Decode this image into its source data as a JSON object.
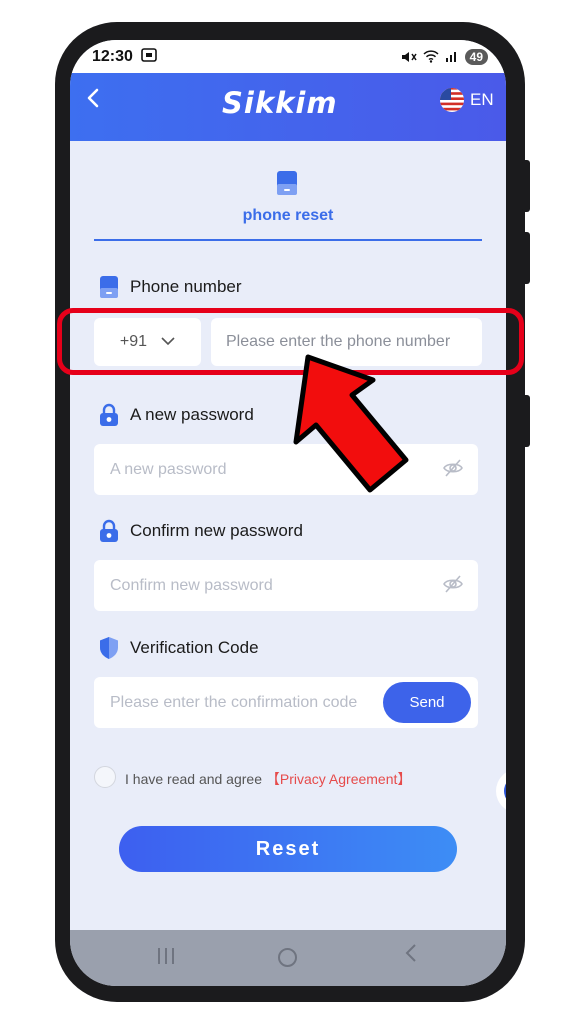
{
  "status_bar": {
    "time": "12:30",
    "battery": "49"
  },
  "header": {
    "logo": "Sikkim",
    "language": "EN"
  },
  "tab": {
    "label": "phone reset"
  },
  "phone": {
    "label": "Phone number",
    "country_code": "+91",
    "placeholder": "Please enter the phone number"
  },
  "password": {
    "label": "A new password",
    "placeholder": "A new password"
  },
  "confirm": {
    "label": "Confirm new password",
    "placeholder": "Confirm new password"
  },
  "verification": {
    "label": "Verification Code",
    "placeholder": "Please enter the confirmation code",
    "send_label": "Send"
  },
  "agreement": {
    "text": "I have read and agree",
    "link": "【Privacy Agreement】"
  },
  "reset_label": "Reset",
  "colors": {
    "accent": "#3b6de9",
    "highlight": "#e6001a",
    "link": "#e64b4b"
  },
  "icons": [
    "back-icon",
    "flag-us-icon",
    "phone-icon",
    "lock-icon",
    "shield-icon",
    "eye-off-icon",
    "chevron-down-icon"
  ]
}
